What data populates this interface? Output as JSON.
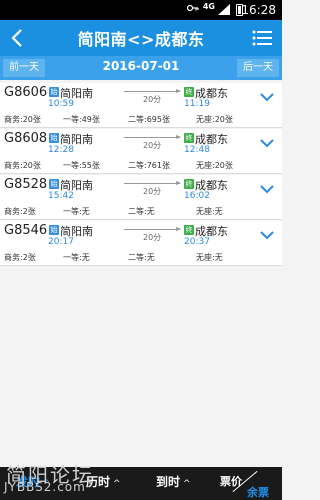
{
  "status_bar": {
    "network": "4G",
    "time": "16:28"
  },
  "header": {
    "title": "简阳南<>成都东"
  },
  "date_bar": {
    "prev_label": "前一天",
    "date": "2016-07-01",
    "next_label": "后一天"
  },
  "trains": [
    {
      "number": "G8606",
      "start_badge": "始",
      "depart_station": "简阳南",
      "depart_time": "10:59",
      "duration": "20分",
      "end_badge": "终",
      "arrive_station": "成都东",
      "arrive_time": "11:19",
      "seats": [
        "商务:20张",
        "一等:49张",
        "二等:695张",
        "无座:20张"
      ]
    },
    {
      "number": "G8608",
      "start_badge": "始",
      "depart_station": "简阳南",
      "depart_time": "12:28",
      "duration": "20分",
      "end_badge": "终",
      "arrive_station": "成都东",
      "arrive_time": "12:48",
      "seats": [
        "商务:20张",
        "一等:55张",
        "二等:761张",
        "无座:20张"
      ]
    },
    {
      "number": "G8528",
      "start_badge": "始",
      "depart_station": "简阳南",
      "depart_time": "15:42",
      "duration": "20分",
      "end_badge": "终",
      "arrive_station": "成都东",
      "arrive_time": "16:02",
      "seats": [
        "商务:2张",
        "一等:无",
        "二等:无",
        "无座:无"
      ]
    },
    {
      "number": "G8546",
      "start_badge": "始",
      "depart_station": "简阳南",
      "depart_time": "20:17",
      "duration": "20分",
      "end_badge": "终",
      "arrive_station": "成都东",
      "arrive_time": "20:37",
      "seats": [
        "商务:2张",
        "一等:无",
        "二等:无",
        "无座:无"
      ]
    }
  ],
  "footer": {
    "depart_sort": "发时",
    "duration_sort": "历时",
    "arrive_sort": "到时",
    "price_sort": "票价",
    "remain_sort": "余票",
    "caret": "^"
  },
  "watermark": {
    "line1": "简阳论坛",
    "line2": "JYBBS2.com"
  },
  "colors": {
    "header": "#1b8fe0",
    "date_bar": "#3aa1ea",
    "accent_time": "#2a8ae0",
    "available": "#3aa35a",
    "start_badge": "#3a8fdc",
    "end_badge": "#3fae48"
  }
}
